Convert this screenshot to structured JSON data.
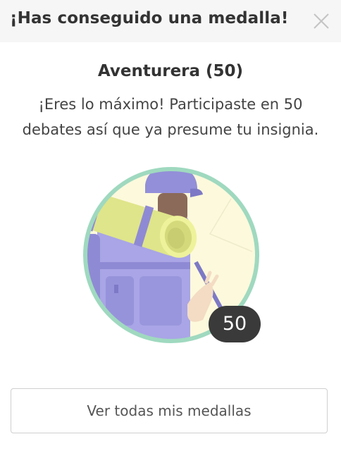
{
  "header": {
    "title": "¡Has conseguido una medalla!",
    "close_icon": "close-icon"
  },
  "badge": {
    "name": "Aventurera (50)",
    "description": "¡Eres lo máximo! Participaste en 50 debates así que ya presume tu insignia.",
    "count": "50",
    "illustration": "backpacker-badge-illustration",
    "colors": {
      "ring": "#9fd9bf",
      "background": "#fdf9dc",
      "backpack": "#a7a3e3",
      "cap": "#8f8ad4",
      "sleeping_mat": "#dfe58a",
      "count_badge": "#3a3a3a"
    }
  },
  "actions": {
    "view_all_label": "Ver todas mis medallas"
  }
}
